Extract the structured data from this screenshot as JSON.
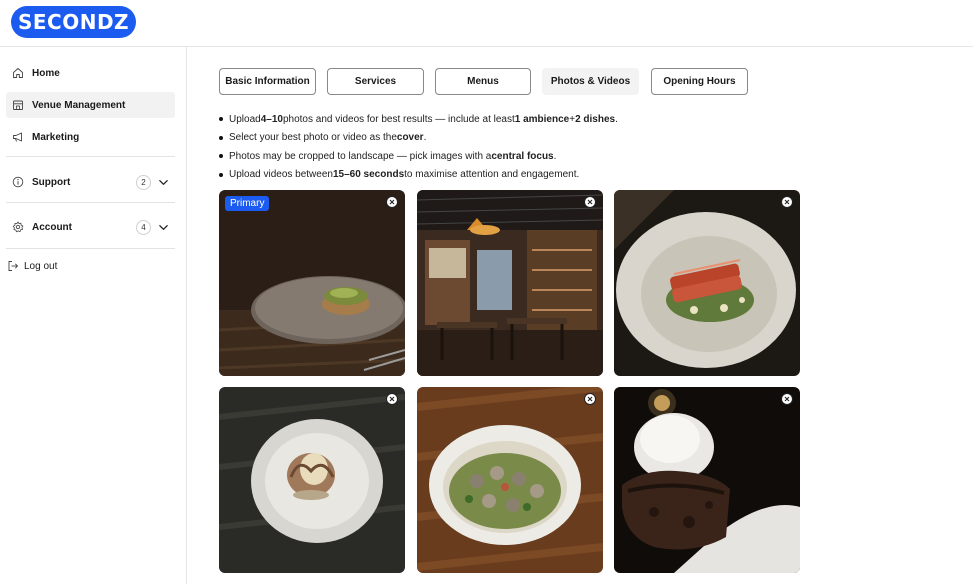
{
  "brand": {
    "logo_text": "SECONDZ",
    "accent": "#1c5bf0"
  },
  "sidebar": {
    "items": [
      {
        "label": "Home",
        "icon": "home-icon"
      },
      {
        "label": "Venue Management",
        "icon": "storefront-icon",
        "active": true
      },
      {
        "label": "Marketing",
        "icon": "megaphone-icon"
      },
      {
        "label": "Support",
        "icon": "info-icon",
        "badge": "2"
      },
      {
        "label": "Account",
        "icon": "gear-icon",
        "badge": "4"
      }
    ],
    "logout": {
      "label": "Log out",
      "icon": "logout-icon"
    }
  },
  "tabs": [
    {
      "label": "Basic Information"
    },
    {
      "label": "Services"
    },
    {
      "label": "Menus"
    },
    {
      "label": "Photos & Videos",
      "active": true
    },
    {
      "label": "Opening Hours"
    }
  ],
  "tips": [
    {
      "parts": [
        "Upload ",
        "4–10",
        " photos and videos for best results — include at least ",
        "1 ambience",
        " + ",
        "2 dishes",
        "."
      ]
    },
    {
      "parts": [
        "Select your best photo or video as the ",
        "cover",
        "."
      ]
    },
    {
      "parts": [
        "Photos may be cropped to landscape — pick images with a ",
        "central focus",
        "."
      ]
    },
    {
      "parts": [
        "Upload videos between ",
        "15–60 seconds",
        " to maximise attention and engagement."
      ]
    }
  ],
  "media": {
    "primary_label": "Primary",
    "items": [
      {
        "subject": "tart-on-plate",
        "primary": true
      },
      {
        "subject": "restaurant-interior"
      },
      {
        "subject": "duck-dish"
      },
      {
        "subject": "meringue-dessert"
      },
      {
        "subject": "clams-bowl"
      },
      {
        "subject": "chocolate-dessert"
      }
    ]
  }
}
